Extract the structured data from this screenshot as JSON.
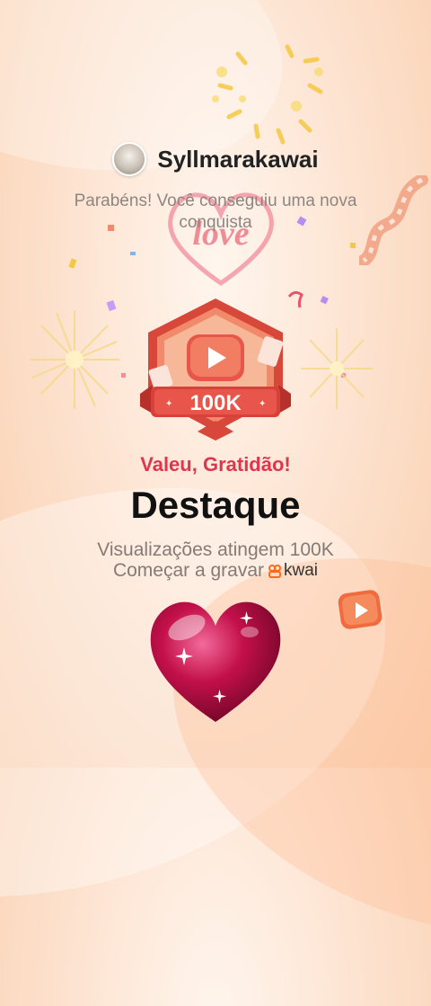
{
  "user": {
    "name": "Syllmarakawai",
    "avatar": "avatar"
  },
  "congrats_text": "Parabéns! Você conseguiu uma nova conquista",
  "love_sticker": {
    "text": "love",
    "icon": "heart-outline-icon"
  },
  "badge": {
    "label": "100K",
    "icon": "play-button-icon",
    "colors": {
      "primary": "#e85a45",
      "dark": "#b8302a",
      "ribbon": "#d8413a"
    }
  },
  "tagline": "Valeu, Gratidão!",
  "title": "Destaque",
  "description": "Visualizações atingem 100K",
  "cta": {
    "text": "Começar a gravar",
    "brand": "kwai",
    "brand_icon": "kwai-logo-icon"
  },
  "colors": {
    "tagline": "#e0364c",
    "title": "#111111",
    "muted": "#857a74",
    "background": "#fde4d2"
  }
}
